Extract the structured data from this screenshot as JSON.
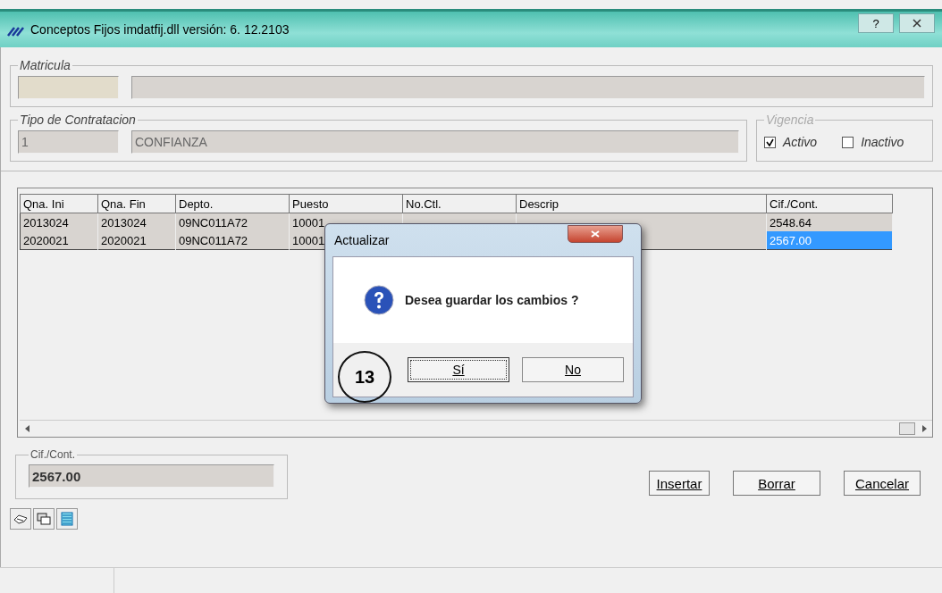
{
  "window": {
    "title": "Conceptos Fijos imdatfij.dll  versión: 6. 12.2103",
    "help_button": "?"
  },
  "matricula": {
    "legend": "Matricula"
  },
  "tipo_contratacion": {
    "legend": "Tipo de Contratacion",
    "code": "1",
    "name": "CONFIANZA"
  },
  "vigencia": {
    "legend": "Vigencia",
    "options": [
      {
        "label": "Activo",
        "checked": true
      },
      {
        "label": "Inactivo",
        "checked": false
      }
    ]
  },
  "table": {
    "columns": [
      "Qna. Ini",
      "Qna. Fin",
      "Depto.",
      "Puesto",
      "No.Ctl.",
      "Descrip",
      "Cif./Cont."
    ],
    "rows": [
      {
        "cells": [
          "2013024",
          "2013024",
          "09NC011A72",
          "10001",
          "",
          "",
          "2548.64"
        ],
        "selected": false
      },
      {
        "cells": [
          "2020021",
          "2020021",
          "09NC011A72",
          "10001",
          "",
          "",
          "2567.00"
        ],
        "selected": true
      }
    ]
  },
  "cif_cont": {
    "legend": "Cif./Cont.",
    "value": "2567.00"
  },
  "buttons": [
    "Insertar",
    "Borrar",
    "Cancelar"
  ],
  "dialog": {
    "title": "Actualizar",
    "message": "Desea guardar los cambios ?",
    "buttons": [
      {
        "label": "Sí",
        "default": true
      },
      {
        "label": "No",
        "default": false
      }
    ]
  },
  "annotation": "13"
}
